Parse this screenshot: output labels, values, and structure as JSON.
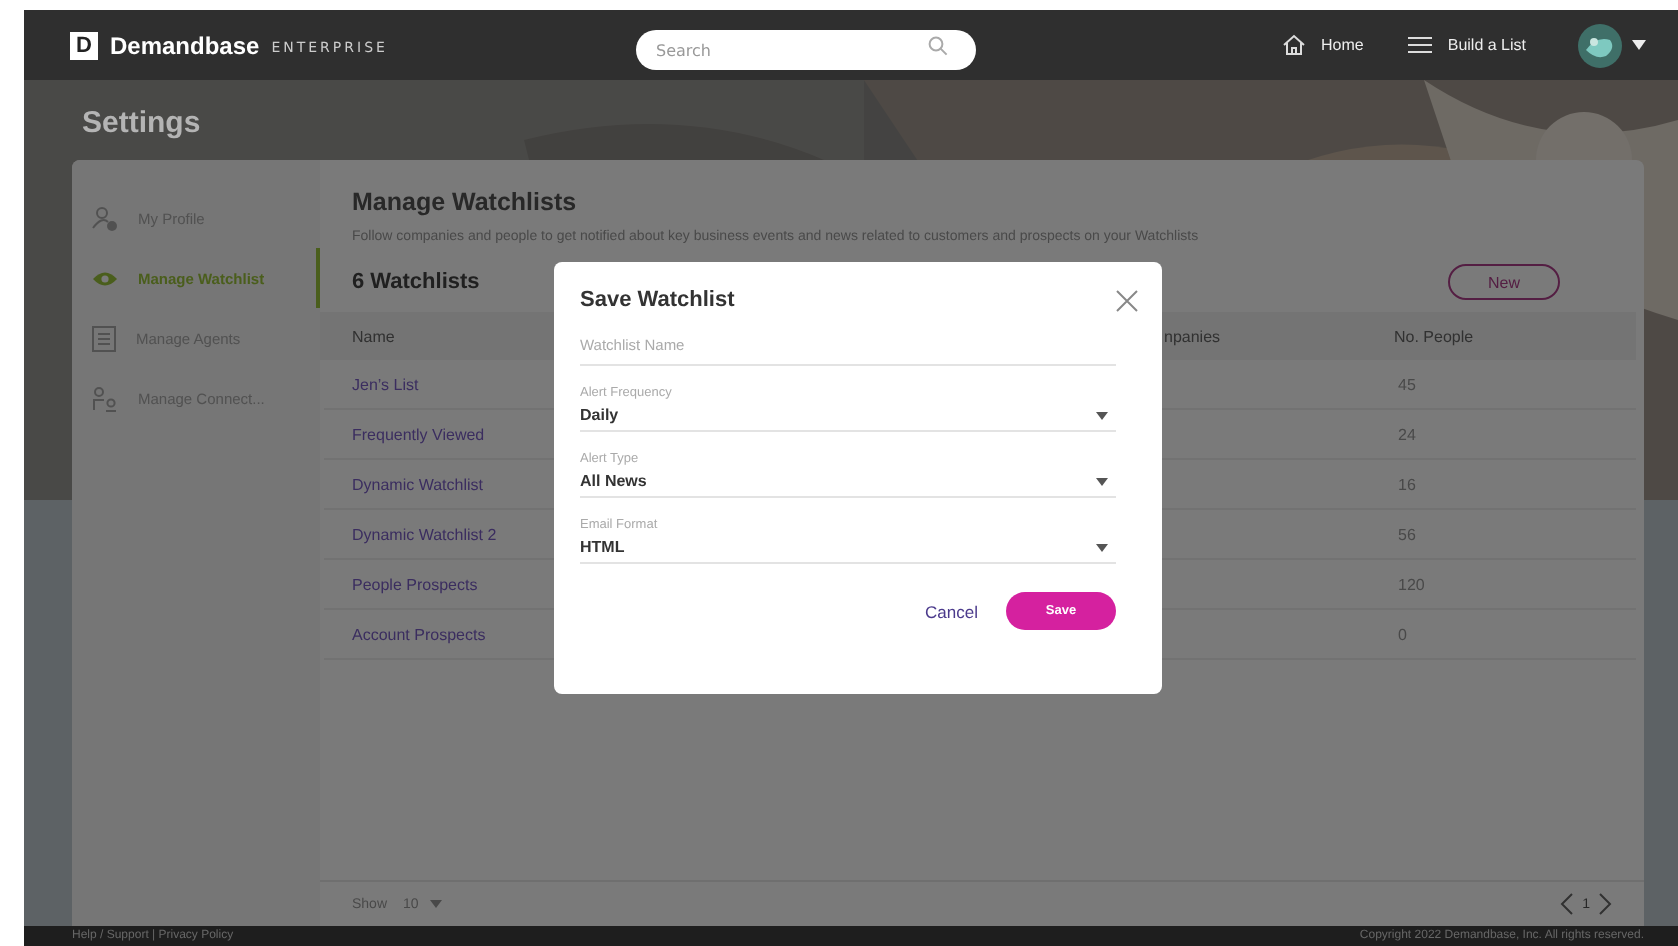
{
  "header": {
    "logo": "D",
    "brand": "Demandbase",
    "edition": "ENTERPRISE",
    "search": {
      "placeholder": "Search"
    },
    "nav": [
      {
        "label": "Home",
        "kind": "home"
      },
      {
        "label": "Build a List",
        "kind": "list"
      }
    ]
  },
  "page_title": "Settings",
  "sidebar": {
    "items": [
      {
        "label": "My Profile",
        "kind": "profile",
        "selected": false
      },
      {
        "label": "Manage Watchlist",
        "kind": "watch",
        "selected": true
      },
      {
        "label": "Manage Agents",
        "kind": "agents",
        "selected": false
      },
      {
        "label": "Manage Connect...",
        "kind": "connect",
        "selected": false
      }
    ]
  },
  "main": {
    "title": "Manage Watchlists",
    "description": "Follow companies and people to get notified about key business events and news related to customers and prospects on your Watchlists",
    "count": "6 Watchlists",
    "new_button": "New",
    "table": {
      "columns": [
        "Name",
        "npanies",
        "No. People"
      ],
      "rows": [
        {
          "name": "Jen’s List",
          "people": "45"
        },
        {
          "name": "Frequently Viewed",
          "people": "24"
        },
        {
          "name": "Dynamic Watchlist",
          "people": "16"
        },
        {
          "name": "Dynamic Watchlist 2",
          "people": "56"
        },
        {
          "name": "People Prospects",
          "people": "120"
        },
        {
          "name": "Account Prospects",
          "people": "0"
        }
      ]
    },
    "show_label": "Show",
    "page_size": "10",
    "page": "1"
  },
  "footer": {
    "links": "Help / Support | Privacy Policy",
    "copyright": "Copyright 2022 Demandbase, Inc. All rights reserved."
  },
  "dialog": {
    "title": "Save Watchlist",
    "fields": [
      {
        "kind": "text",
        "placeholder": "Watchlist Name"
      },
      {
        "kind": "select",
        "label": "Alert Frequency",
        "value": "Daily"
      },
      {
        "kind": "select",
        "label": "Alert Type",
        "value": "All News"
      },
      {
        "kind": "select",
        "label": "Email Format",
        "value": "HTML"
      }
    ],
    "cancel": "Cancel",
    "save": "Save"
  }
}
